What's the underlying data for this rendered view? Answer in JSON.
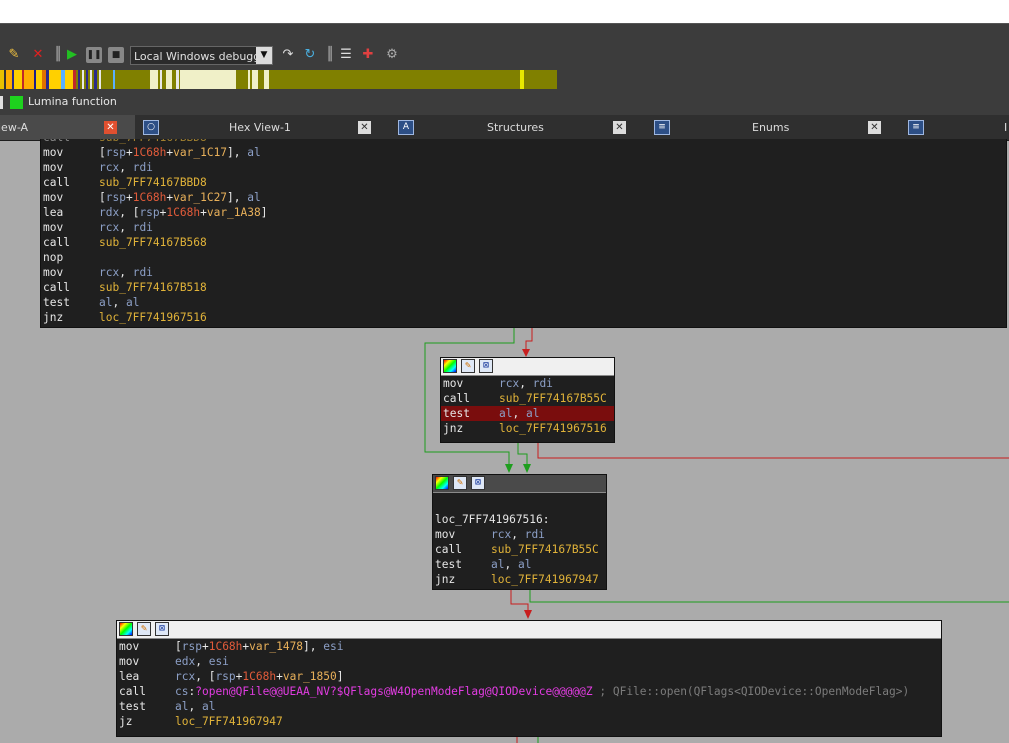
{
  "toolbar": {
    "debugger_select": "Local Windows debugger"
  },
  "legend": {
    "lumina_label": "Lumina function",
    "lumina_color": "#1ed21e"
  },
  "tabs": [
    {
      "label": "IDA View-A",
      "visible": "iew-A"
    },
    {
      "label": "Hex View-1"
    },
    {
      "label": "Structures"
    },
    {
      "label": "Enums"
    },
    {
      "label": "I"
    }
  ],
  "block1": {
    "lines": [
      {
        "m": "mov",
        "o": "[rsp+1C68h+var_1C17], al"
      },
      {
        "m": "mov",
        "o": "rcx, rdi"
      },
      {
        "m": "call",
        "o": "sub_7FF74167BBD8"
      },
      {
        "m": "mov",
        "o": "[rsp+1C68h+var_1C27], al"
      },
      {
        "m": "lea",
        "o": "rdx, [rsp+1C68h+var_1A38]"
      },
      {
        "m": "mov",
        "o": "rcx, rdi"
      },
      {
        "m": "call",
        "o": "sub_7FF74167B568"
      },
      {
        "m": "nop",
        "o": ""
      },
      {
        "m": "mov",
        "o": "rcx, rdi"
      },
      {
        "m": "call",
        "o": "sub_7FF74167B518"
      },
      {
        "m": "test",
        "o": "al, al"
      },
      {
        "m": "jnz",
        "o": "loc_7FF741967516"
      }
    ]
  },
  "block2": {
    "lines": [
      {
        "m": "mov",
        "o": "rcx, rdi"
      },
      {
        "m": "call",
        "o": "sub_7FF74167B55C"
      },
      {
        "m": "test",
        "o": "al, al"
      },
      {
        "m": "jnz",
        "o": "loc_7FF741967516"
      }
    ]
  },
  "block3": {
    "label": "loc_7FF741967516:",
    "lines": [
      {
        "m": "mov",
        "o": "rcx, rdi"
      },
      {
        "m": "call",
        "o": "sub_7FF74167B55C"
      },
      {
        "m": "test",
        "o": "al, al"
      },
      {
        "m": "jnz",
        "o": "loc_7FF741967947"
      }
    ]
  },
  "block4": {
    "lines": [
      {
        "m": "mov",
        "o": "[rsp+1C68h+var_1478], esi"
      },
      {
        "m": "mov",
        "o": "edx, esi"
      },
      {
        "m": "lea",
        "o": "rcx, [rsp+1C68h+var_1850]"
      },
      {
        "m": "call",
        "o": "cs:?open@QFile@@UEAA_NV?$QFlags@W4OpenModeFlag@QIODevice@@@@@Z"
      },
      {
        "m": "test",
        "o": "al, al"
      },
      {
        "m": "jz",
        "o": "loc_7FF741967947"
      }
    ],
    "comment": "; QFile::open(QFlags<QIODevice::OpenModeFlag>)"
  },
  "colors": {
    "edge_true": "#1e9e1e",
    "edge_false": "#c81e1e",
    "edge_uncond": "#3232c8"
  }
}
